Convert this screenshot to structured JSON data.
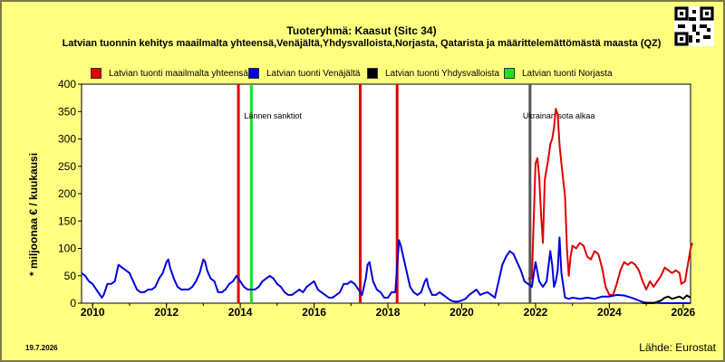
{
  "header": {
    "title": "Tuoteryhmä: Kaasut (Sitc 34)",
    "subtitle": "Latvian tuonnin kehitys maailmalta yhteensä,Venäjältä,Yhdysvalloista,Norjasta, Qatarista ja määrittelemättömästä maasta (QZ)"
  },
  "footer": {
    "date": "19.7.2026",
    "source": "Lähde: Eurostat"
  },
  "qr_icon": "qr-code-icon",
  "chart_data": {
    "type": "line",
    "ylabel": "* miljoonaa € / kuukausi",
    "xlabel": "",
    "xlim": [
      2009.7,
      2026.2
    ],
    "ylim": [
      0,
      400
    ],
    "x_ticks": [
      "2010",
      "2012",
      "2014",
      "2016",
      "2018",
      "2020",
      "2022",
      "2024",
      "2026"
    ],
    "y_ticks": [
      "0",
      "50",
      "100",
      "150",
      "200",
      "250",
      "300",
      "350",
      "400"
    ],
    "grid": false,
    "legend_position": "top",
    "events": [
      {
        "x": 2013.95,
        "color": "#e00000",
        "label": ""
      },
      {
        "x": 2014.3,
        "color": "#22dd22",
        "label": "Lännen sanktiot"
      },
      {
        "x": 2017.25,
        "color": "#e00000",
        "label": ""
      },
      {
        "x": 2018.25,
        "color": "#e00000",
        "label": ""
      },
      {
        "x": 2021.85,
        "color": "#555555",
        "label": "Ukrainan sota alkaa"
      }
    ],
    "series": [
      {
        "name": "Latvian tuonti maailmalta yhteensä",
        "color": "#e00000",
        "points": [
          [
            2021.8,
            45
          ],
          [
            2021.9,
            45
          ],
          [
            2022.0,
            255
          ],
          [
            2022.05,
            265
          ],
          [
            2022.1,
            230
          ],
          [
            2022.15,
            160
          ],
          [
            2022.2,
            110
          ],
          [
            2022.25,
            225
          ],
          [
            2022.3,
            245
          ],
          [
            2022.35,
            265
          ],
          [
            2022.4,
            290
          ],
          [
            2022.45,
            300
          ],
          [
            2022.5,
            320
          ],
          [
            2022.55,
            355
          ],
          [
            2022.6,
            345
          ],
          [
            2022.65,
            290
          ],
          [
            2022.7,
            255
          ],
          [
            2022.75,
            225
          ],
          [
            2022.8,
            195
          ],
          [
            2022.85,
            100
          ],
          [
            2022.9,
            50
          ],
          [
            2022.95,
            85
          ],
          [
            2023.0,
            105
          ],
          [
            2023.1,
            100
          ],
          [
            2023.2,
            110
          ],
          [
            2023.3,
            105
          ],
          [
            2023.4,
            85
          ],
          [
            2023.5,
            80
          ],
          [
            2023.6,
            95
          ],
          [
            2023.7,
            90
          ],
          [
            2023.8,
            65
          ],
          [
            2023.9,
            30
          ],
          [
            2024.0,
            15
          ],
          [
            2024.1,
            15
          ],
          [
            2024.2,
            35
          ],
          [
            2024.3,
            60
          ],
          [
            2024.4,
            75
          ],
          [
            2024.5,
            70
          ],
          [
            2024.6,
            75
          ],
          [
            2024.7,
            70
          ],
          [
            2024.8,
            60
          ],
          [
            2024.9,
            40
          ],
          [
            2025.0,
            25
          ],
          [
            2025.1,
            40
          ],
          [
            2025.2,
            30
          ],
          [
            2025.3,
            40
          ],
          [
            2025.4,
            50
          ],
          [
            2025.5,
            65
          ],
          [
            2025.6,
            60
          ],
          [
            2025.7,
            55
          ],
          [
            2025.8,
            60
          ],
          [
            2025.9,
            55
          ],
          [
            2025.95,
            35
          ],
          [
            2026.05,
            40
          ],
          [
            2026.2,
            100
          ],
          [
            2026.25,
            110
          ]
        ]
      },
      {
        "name": "Latvian tuonti Venäjältä",
        "color": "#0000e0",
        "points": [
          [
            2009.7,
            55
          ],
          [
            2009.8,
            50
          ],
          [
            2009.9,
            40
          ],
          [
            2010.0,
            35
          ],
          [
            2010.1,
            25
          ],
          [
            2010.2,
            15
          ],
          [
            2010.25,
            10
          ],
          [
            2010.3,
            15
          ],
          [
            2010.4,
            35
          ],
          [
            2010.5,
            35
          ],
          [
            2010.6,
            40
          ],
          [
            2010.7,
            70
          ],
          [
            2010.8,
            65
          ],
          [
            2010.9,
            60
          ],
          [
            2011.0,
            55
          ],
          [
            2011.1,
            40
          ],
          [
            2011.2,
            25
          ],
          [
            2011.3,
            20
          ],
          [
            2011.4,
            20
          ],
          [
            2011.5,
            25
          ],
          [
            2011.6,
            25
          ],
          [
            2011.7,
            30
          ],
          [
            2011.8,
            45
          ],
          [
            2011.9,
            55
          ],
          [
            2012.0,
            75
          ],
          [
            2012.05,
            80
          ],
          [
            2012.1,
            65
          ],
          [
            2012.2,
            45
          ],
          [
            2012.3,
            30
          ],
          [
            2012.4,
            25
          ],
          [
            2012.5,
            25
          ],
          [
            2012.6,
            25
          ],
          [
            2012.7,
            30
          ],
          [
            2012.8,
            40
          ],
          [
            2012.9,
            55
          ],
          [
            2013.0,
            80
          ],
          [
            2013.05,
            75
          ],
          [
            2013.1,
            60
          ],
          [
            2013.2,
            45
          ],
          [
            2013.3,
            40
          ],
          [
            2013.4,
            20
          ],
          [
            2013.5,
            20
          ],
          [
            2013.6,
            25
          ],
          [
            2013.7,
            35
          ],
          [
            2013.8,
            40
          ],
          [
            2013.9,
            50
          ],
          [
            2014.0,
            40
          ],
          [
            2014.1,
            30
          ],
          [
            2014.2,
            25
          ],
          [
            2014.3,
            25
          ],
          [
            2014.4,
            25
          ],
          [
            2014.5,
            30
          ],
          [
            2014.6,
            40
          ],
          [
            2014.7,
            45
          ],
          [
            2014.8,
            50
          ],
          [
            2014.9,
            45
          ],
          [
            2015.0,
            35
          ],
          [
            2015.1,
            30
          ],
          [
            2015.2,
            20
          ],
          [
            2015.3,
            15
          ],
          [
            2015.4,
            15
          ],
          [
            2015.5,
            20
          ],
          [
            2015.6,
            25
          ],
          [
            2015.7,
            20
          ],
          [
            2015.8,
            30
          ],
          [
            2015.9,
            35
          ],
          [
            2016.0,
            40
          ],
          [
            2016.1,
            25
          ],
          [
            2016.2,
            20
          ],
          [
            2016.3,
            15
          ],
          [
            2016.4,
            10
          ],
          [
            2016.5,
            10
          ],
          [
            2016.6,
            15
          ],
          [
            2016.7,
            20
          ],
          [
            2016.8,
            35
          ],
          [
            2016.9,
            35
          ],
          [
            2017.0,
            40
          ],
          [
            2017.1,
            35
          ],
          [
            2017.2,
            25
          ],
          [
            2017.3,
            15
          ],
          [
            2017.4,
            45
          ],
          [
            2017.45,
            70
          ],
          [
            2017.5,
            75
          ],
          [
            2017.6,
            40
          ],
          [
            2017.7,
            25
          ],
          [
            2017.8,
            20
          ],
          [
            2017.9,
            10
          ],
          [
            2018.0,
            10
          ],
          [
            2018.1,
            20
          ],
          [
            2018.2,
            20
          ],
          [
            2018.3,
            115
          ],
          [
            2018.35,
            105
          ],
          [
            2018.4,
            90
          ],
          [
            2018.5,
            60
          ],
          [
            2018.6,
            30
          ],
          [
            2018.7,
            20
          ],
          [
            2018.8,
            15
          ],
          [
            2018.9,
            20
          ],
          [
            2019.0,
            40
          ],
          [
            2019.05,
            45
          ],
          [
            2019.1,
            30
          ],
          [
            2019.2,
            15
          ],
          [
            2019.3,
            15
          ],
          [
            2019.4,
            20
          ],
          [
            2019.5,
            15
          ],
          [
            2019.6,
            10
          ],
          [
            2019.7,
            5
          ],
          [
            2019.8,
            3
          ],
          [
            2019.9,
            3
          ],
          [
            2020.0,
            5
          ],
          [
            2020.1,
            8
          ],
          [
            2020.2,
            15
          ],
          [
            2020.3,
            20
          ],
          [
            2020.4,
            25
          ],
          [
            2020.5,
            15
          ],
          [
            2020.6,
            18
          ],
          [
            2020.7,
            20
          ],
          [
            2020.8,
            15
          ],
          [
            2020.9,
            10
          ],
          [
            2021.0,
            40
          ],
          [
            2021.1,
            70
          ],
          [
            2021.2,
            85
          ],
          [
            2021.3,
            95
          ],
          [
            2021.4,
            90
          ],
          [
            2021.5,
            75
          ],
          [
            2021.6,
            60
          ],
          [
            2021.7,
            40
          ],
          [
            2021.8,
            35
          ],
          [
            2021.9,
            30
          ],
          [
            2022.0,
            75
          ],
          [
            2022.1,
            40
          ],
          [
            2022.2,
            30
          ],
          [
            2022.3,
            40
          ],
          [
            2022.4,
            95
          ],
          [
            2022.45,
            70
          ],
          [
            2022.5,
            30
          ],
          [
            2022.55,
            40
          ],
          [
            2022.6,
            60
          ],
          [
            2022.65,
            120
          ],
          [
            2022.7,
            55
          ],
          [
            2022.8,
            10
          ],
          [
            2022.9,
            8
          ],
          [
            2023.0,
            10
          ],
          [
            2023.2,
            8
          ],
          [
            2023.4,
            10
          ],
          [
            2023.6,
            8
          ],
          [
            2023.8,
            12
          ],
          [
            2024.0,
            12
          ],
          [
            2024.2,
            15
          ],
          [
            2024.4,
            14
          ],
          [
            2024.6,
            10
          ],
          [
            2024.8,
            5
          ],
          [
            2024.9,
            2
          ],
          [
            2025.0,
            1
          ],
          [
            2025.5,
            0
          ],
          [
            2026.2,
            0
          ]
        ]
      },
      {
        "name": "Latvian tuonti Yhdysvalloista",
        "color": "#000000",
        "points": [
          [
            2024.9,
            0
          ],
          [
            2025.2,
            0
          ],
          [
            2025.4,
            5
          ],
          [
            2025.5,
            10
          ],
          [
            2025.6,
            12
          ],
          [
            2025.7,
            8
          ],
          [
            2025.8,
            10
          ],
          [
            2025.9,
            12
          ],
          [
            2026.0,
            8
          ],
          [
            2026.1,
            14
          ],
          [
            2026.2,
            10
          ]
        ]
      },
      {
        "name": "Latvian tuonti Norjasta",
        "color": "#22dd22",
        "points": []
      }
    ]
  }
}
